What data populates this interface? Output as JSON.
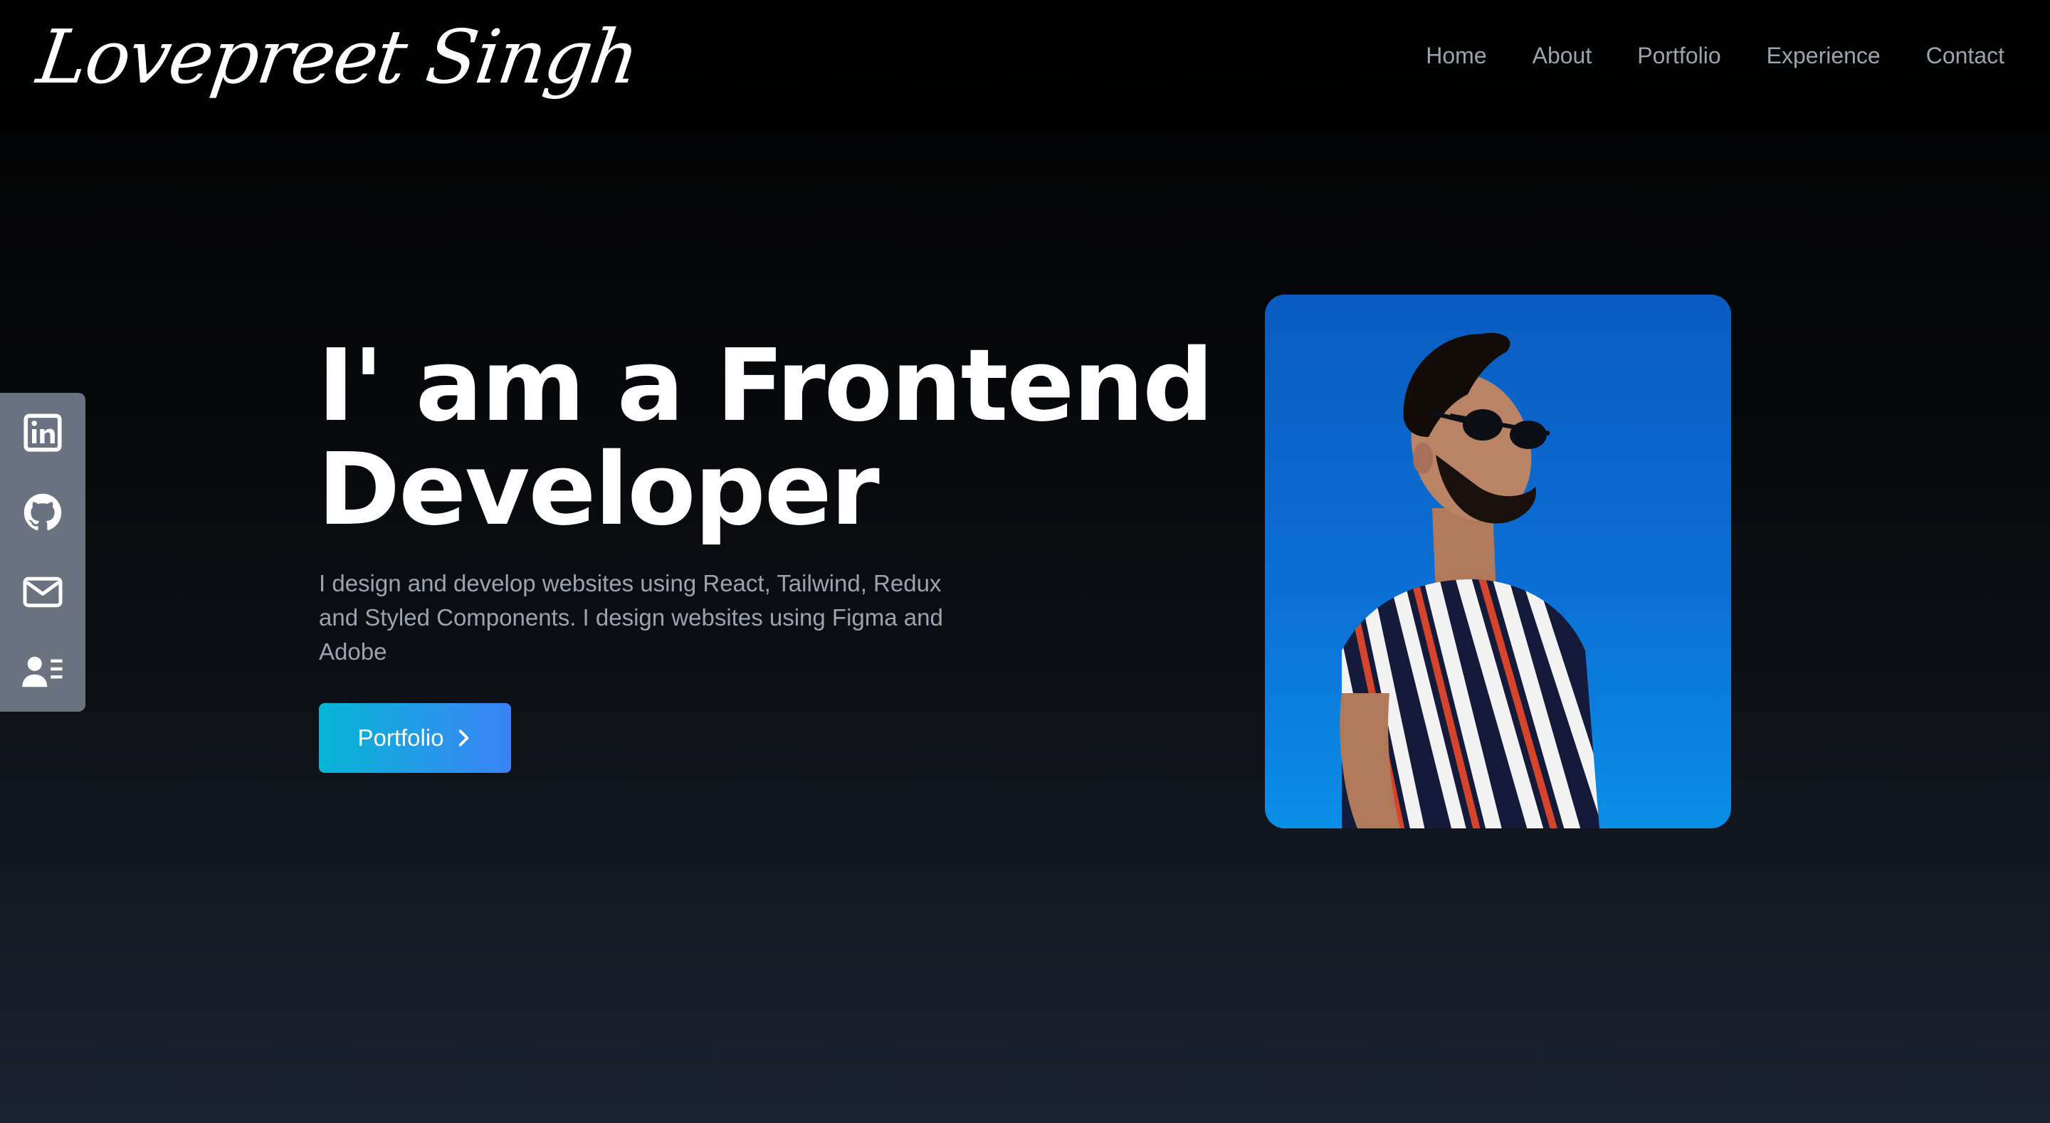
{
  "header": {
    "logo": "Lovepreet Singh",
    "nav": [
      "Home",
      "About",
      "Portfolio",
      "Experience",
      "Contact"
    ]
  },
  "social": [
    {
      "icon": "linkedin-icon"
    },
    {
      "icon": "github-icon"
    },
    {
      "icon": "mail-icon"
    },
    {
      "icon": "resume-icon"
    }
  ],
  "hero": {
    "title_line1": "I' am a Frontend",
    "title_line2": "Developer",
    "description": "I design and develop websites using React, Tailwind, Redux and Styled Components. I design websites using Figma and Adobe",
    "button_label": "Portfolio",
    "button_icon": "chevron-right-icon"
  },
  "colors": {
    "background_top": "#000000",
    "background_bottom": "#1b2230",
    "muted_text": "#9ca3af",
    "sidebar": "#6b7280",
    "button_gradient_start": "#06b6d4",
    "button_gradient_end": "#3b82f6",
    "portrait_sky": "#0b6fd4"
  }
}
